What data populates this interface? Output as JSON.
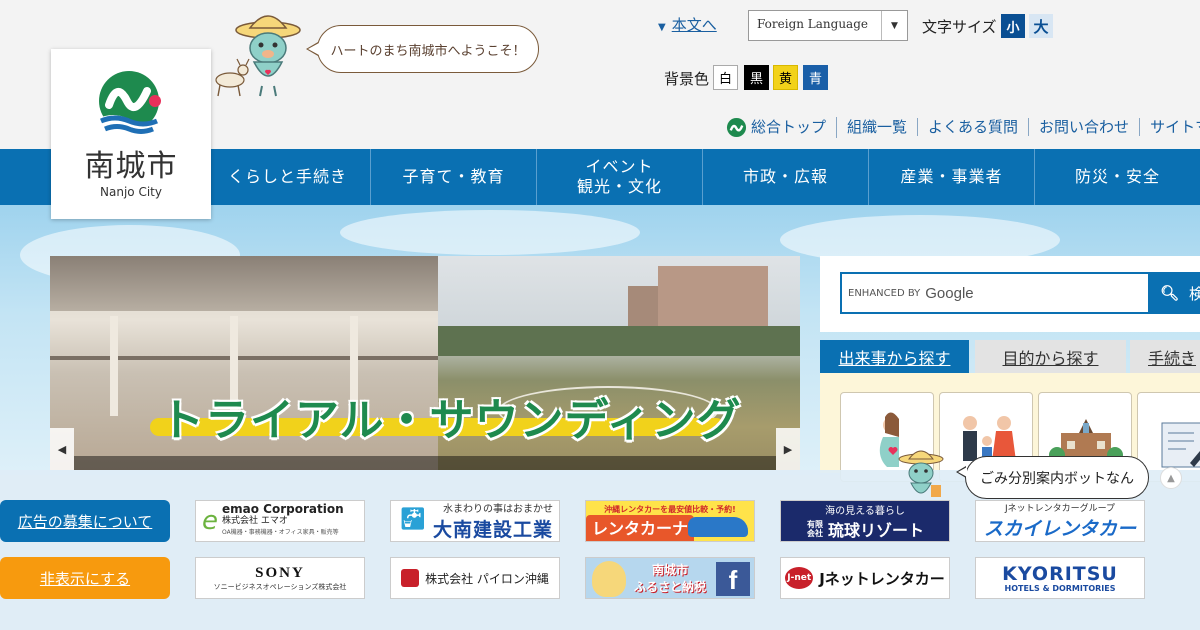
{
  "header": {
    "city_name": "南城市",
    "city_name_en": "Nanjo City",
    "welcome_bubble": "ハートのまち南城市へようこそ！",
    "skip_link": "本文へ",
    "language_select": "Foreign Language",
    "font_size_label": "文字サイズ",
    "font_small": "小",
    "font_large": "大",
    "bg_color_label": "背景色",
    "bg_colors": [
      "白",
      "黒",
      "黄",
      "青"
    ],
    "utility_links": [
      "総合トップ",
      "組織一覧",
      "よくある質問",
      "お問い合わせ",
      "サイトマ"
    ]
  },
  "nav": {
    "items": [
      "くらしと手続き",
      "子育て・教育",
      "イベント\n観光・文化",
      "市政・広報",
      "産業・事業者",
      "防災・安全"
    ]
  },
  "slider": {
    "title": "トライアル・サウンディング"
  },
  "search": {
    "enhanced_by": "ENHANCED BY",
    "google": "Google",
    "button_label": "検"
  },
  "tabs": [
    "出来事から探す",
    "目的から探す",
    "手続き"
  ],
  "ads": {
    "recruit_button": "広告の募集について",
    "hide_button": "非表示にする",
    "row1": [
      {
        "title": "emao Corporation",
        "sub": "株式会社 エマオ",
        "small": "OA機器・事務機器・オフィス家具・販売等",
        "badge": "emao"
      },
      {
        "title": "大南建設工業",
        "sub": "水まわりの事はおまかせ"
      },
      {
        "title": "レンタカーナビ",
        "sub": "沖縄レンタカーを最安値比較・予約!"
      },
      {
        "title": "琉球リゾート",
        "sub": "海の見える暮らし",
        "prefix": "有限会社"
      },
      {
        "title": "スカイレンタカー",
        "sub": "Jネットレンタカーグループ"
      }
    ],
    "row2": [
      {
        "title": "SONY",
        "sub": "ソニービジネスオペレーションズ株式会社"
      },
      {
        "title": "株式会社 パイロン沖縄"
      },
      {
        "title": "南城市",
        "sub": "ふるさと納税"
      },
      {
        "title": "Jネットレンタカー",
        "badge": "J-net"
      },
      {
        "title": "KYORITSU",
        "sub": "HOTELS & DORMITORIES"
      }
    ]
  },
  "chatbot": {
    "bubble": "ごみ分別案内ボットなん"
  },
  "colors": {
    "nav_blue": "#0a70b2",
    "orange": "#f79a0e",
    "logo_green": "#1e8a4e",
    "logo_red": "#e8315b"
  }
}
